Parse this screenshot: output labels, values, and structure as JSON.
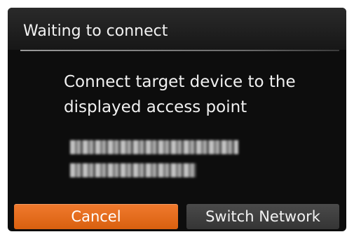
{
  "header": {
    "title": "Waiting to connect"
  },
  "message": {
    "line1": "Connect target device to the",
    "line2": "displayed access point"
  },
  "buttons": {
    "cancel_label": "Cancel",
    "switch_network_label": "Switch Network"
  },
  "colors": {
    "screen_background": "#0d0d0d",
    "cancel_button": "#e86b1e",
    "switch_network_button": "#404040",
    "text": "#f0f0f0"
  }
}
